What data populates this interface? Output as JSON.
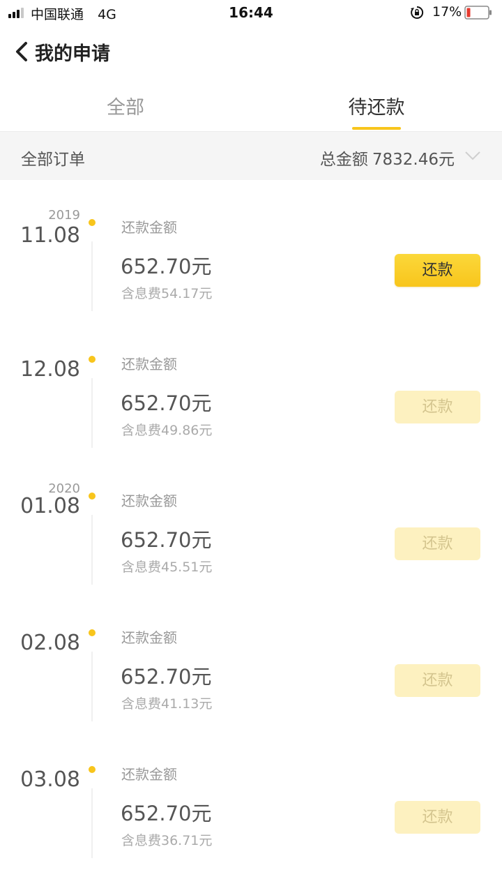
{
  "status_bar": {
    "carrier": "中国联通",
    "network": "4G",
    "time": "16:44",
    "battery": "17%"
  },
  "header": {
    "title": "我的申请"
  },
  "tabs": [
    {
      "label": "全部",
      "active": false
    },
    {
      "label": "待还款",
      "active": true
    }
  ],
  "summary": {
    "left_label": "全部订单",
    "total_label": "总金额",
    "total_amount": "7832.46元"
  },
  "items": [
    {
      "year": "2019",
      "date": "11.08",
      "label": "还款金额",
      "amount": "652.70元",
      "fee": "含息费54.17元",
      "button": "还款",
      "enabled": true
    },
    {
      "year": "",
      "date": "12.08",
      "label": "还款金额",
      "amount": "652.70元",
      "fee": "含息费49.86元",
      "button": "还款",
      "enabled": false
    },
    {
      "year": "2020",
      "date": "01.08",
      "label": "还款金额",
      "amount": "652.70元",
      "fee": "含息费45.51元",
      "button": "还款",
      "enabled": false
    },
    {
      "year": "",
      "date": "02.08",
      "label": "还款金额",
      "amount": "652.70元",
      "fee": "含息费41.13元",
      "button": "还款",
      "enabled": false
    },
    {
      "year": "",
      "date": "03.08",
      "label": "还款金额",
      "amount": "652.70元",
      "fee": "含息费36.71元",
      "button": "还款",
      "enabled": false
    }
  ],
  "colors": {
    "accent": "#f8c51c",
    "accent_disabled": "#fdf1c0",
    "battery_low": "#e63a2f"
  },
  "icons": {
    "back": "chevron-left-icon",
    "summary_expand": "chevron-down-icon",
    "rotation_lock": "rotation-lock-icon",
    "battery": "battery-icon",
    "signal": "signal-icon"
  }
}
